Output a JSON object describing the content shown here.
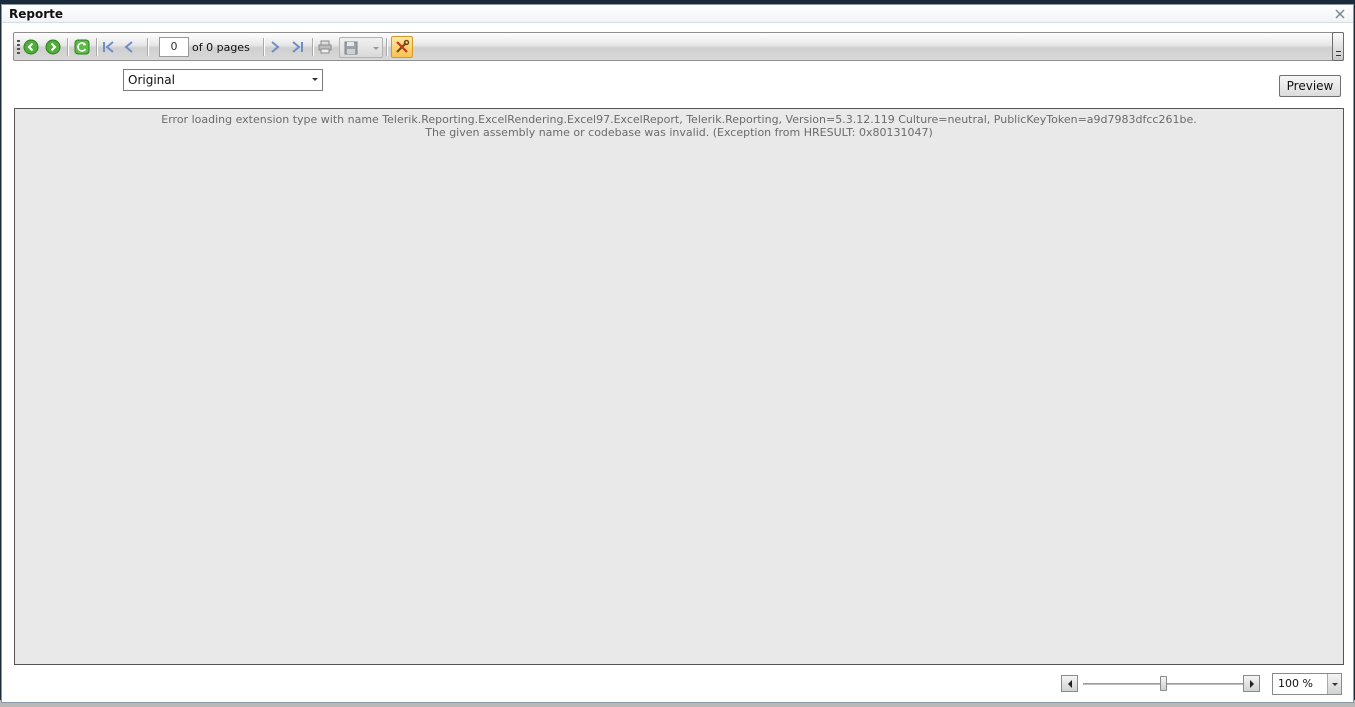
{
  "window": {
    "title": "Reporte"
  },
  "toolbar": {
    "page_value": "0",
    "of_pages_label": "of 0 pages"
  },
  "icons": [
    "back-icon",
    "forward-icon",
    "refresh-icon",
    "first-page-icon",
    "previous-page-icon",
    "next-page-icon",
    "last-page-icon",
    "print-icon",
    "save-icon",
    "tools-icon"
  ],
  "format_select": {
    "selected": "Original"
  },
  "preview_button": {
    "label": "Preview"
  },
  "report": {
    "error_line1": "Error loading extension type with name Telerik.Reporting.ExcelRendering.Excel97.ExcelReport, Telerik.Reporting, Version=5.3.12.119 Culture=neutral, PublicKeyToken=a9d7983dfcc261be.",
    "error_line2": "The given assembly name or codebase was invalid. (Exception from HRESULT: 0x80131047)"
  },
  "zoom": {
    "value": "100 %",
    "level_fraction": 0.5
  },
  "colors": {
    "accent": "#f8c350",
    "nav_green": "#4fae3a",
    "nav_blue": "#6c8fc5",
    "report_bg": "#e9e9e9"
  }
}
